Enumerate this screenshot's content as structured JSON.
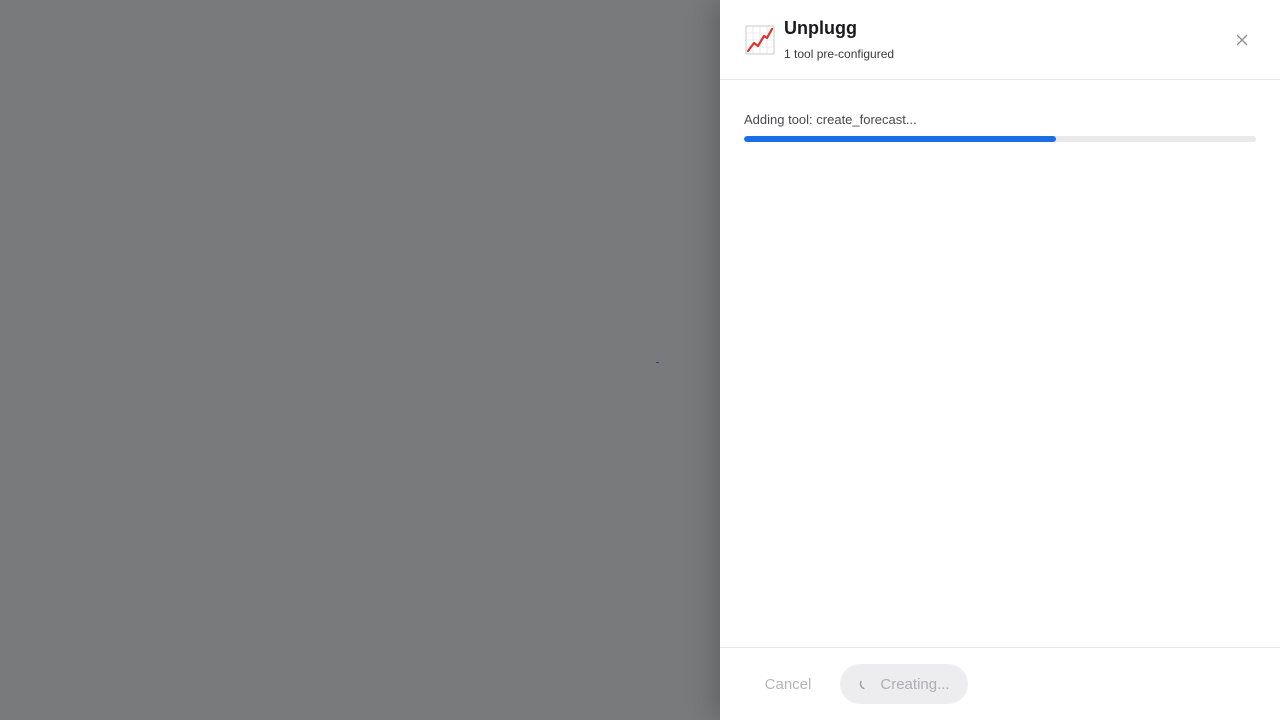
{
  "overlay": {
    "color": "#797a7c"
  },
  "drawer": {
    "header": {
      "icon": "chart-increasing-icon",
      "title": "Unplugg",
      "subtitle": "1 tool pre-configured",
      "close_icon": "close-icon"
    },
    "progress": {
      "label": "Adding tool: create_forecast...",
      "percent": 61,
      "accent": "#1a6fe6"
    },
    "footer": {
      "cancel_label": "Cancel",
      "create_label": "Creating...",
      "create_icon": "spinner-icon"
    }
  }
}
